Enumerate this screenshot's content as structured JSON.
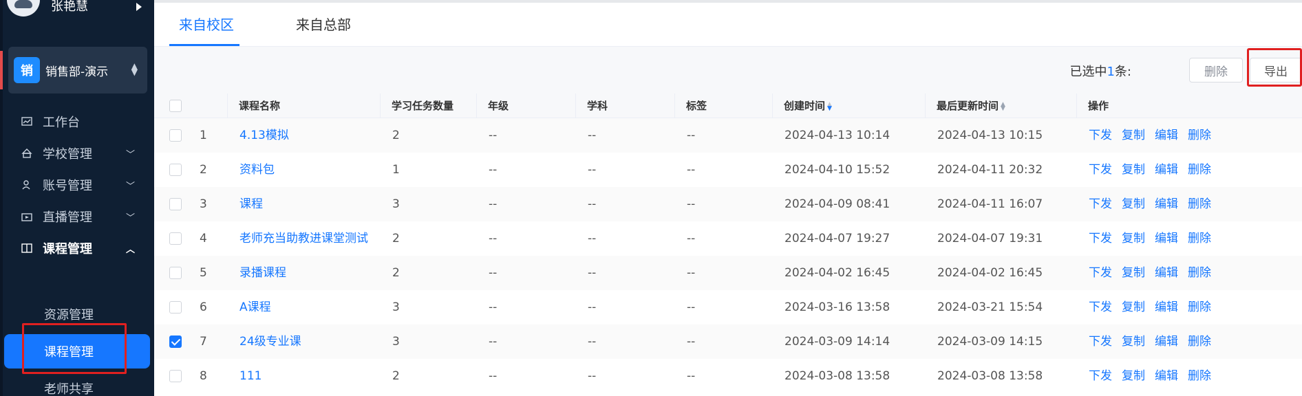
{
  "sidebar": {
    "user_name": "张艳慧",
    "org": {
      "badge": "销",
      "name": "销售部-演示"
    },
    "menu": [
      {
        "label": "工作台",
        "icon": "chart-icon"
      },
      {
        "label": "学校管理",
        "icon": "school-icon"
      },
      {
        "label": "账号管理",
        "icon": "users-icon"
      },
      {
        "label": "直播管理",
        "icon": "live-icon"
      },
      {
        "label": "课程管理",
        "icon": "book-icon"
      }
    ],
    "submenu": [
      "资源管理",
      "课程管理",
      "老师共享"
    ]
  },
  "tabs": [
    "来自校区",
    "来自总部"
  ],
  "toolbar": {
    "selected_prefix": "已选中",
    "selected_count": "1",
    "selected_suffix": "条:",
    "delete_label": "删除",
    "export_label": "导出"
  },
  "table": {
    "headers": [
      "课程名称",
      "学习任务数量",
      "年级",
      "学科",
      "标签",
      "创建时间",
      "最后更新时间",
      "操作"
    ],
    "actions": [
      "下发",
      "复制",
      "编辑",
      "删除"
    ],
    "rows": [
      {
        "idx": "1",
        "name": "4.13模拟",
        "count": "2",
        "grade": "--",
        "subject": "--",
        "tag": "--",
        "created": "2024-04-13 10:14",
        "updated": "2024-04-13 10:15",
        "checked": false
      },
      {
        "idx": "2",
        "name": "资料包",
        "count": "1",
        "grade": "--",
        "subject": "--",
        "tag": "--",
        "created": "2024-04-10 15:52",
        "updated": "2024-04-11 20:32",
        "checked": false
      },
      {
        "idx": "3",
        "name": "课程",
        "count": "3",
        "grade": "--",
        "subject": "--",
        "tag": "--",
        "created": "2024-04-09 08:41",
        "updated": "2024-04-11 16:07",
        "checked": false
      },
      {
        "idx": "4",
        "name": "老师充当助教进课堂测试",
        "count": "2",
        "grade": "--",
        "subject": "--",
        "tag": "--",
        "created": "2024-04-07 19:27",
        "updated": "2024-04-07 19:31",
        "checked": false
      },
      {
        "idx": "5",
        "name": "录播课程",
        "count": "2",
        "grade": "--",
        "subject": "--",
        "tag": "--",
        "created": "2024-04-02 16:45",
        "updated": "2024-04-02 16:45",
        "checked": false
      },
      {
        "idx": "6",
        "name": "A课程",
        "count": "3",
        "grade": "--",
        "subject": "--",
        "tag": "--",
        "created": "2024-03-16 13:58",
        "updated": "2024-03-21 15:54",
        "checked": false
      },
      {
        "idx": "7",
        "name": "24级专业课",
        "count": "3",
        "grade": "--",
        "subject": "--",
        "tag": "--",
        "created": "2024-03-09 14:14",
        "updated": "2024-03-09 14:15",
        "checked": true
      },
      {
        "idx": "8",
        "name": "111",
        "count": "2",
        "grade": "--",
        "subject": "--",
        "tag": "--",
        "created": "2024-03-08 13:58",
        "updated": "2024-03-08 13:58",
        "checked": false
      }
    ]
  }
}
